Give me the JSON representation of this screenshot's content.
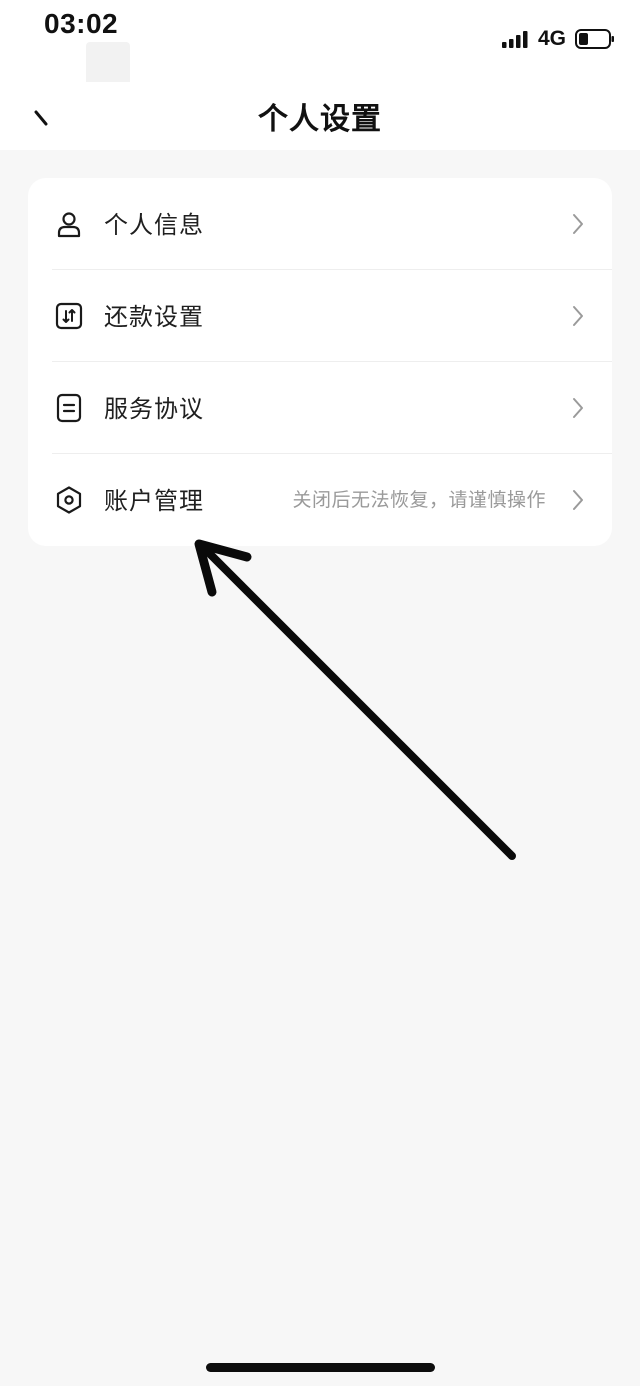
{
  "status_bar": {
    "time": "03:02",
    "network": "4G",
    "icons": [
      "signal-icon",
      "battery-icon"
    ]
  },
  "nav": {
    "title": "个人设置",
    "back_icon": "back-arrow-icon"
  },
  "settings": {
    "items": [
      {
        "label": "个人信息",
        "icon": "person-icon",
        "hint": ""
      },
      {
        "label": "还款设置",
        "icon": "repayment-icon",
        "hint": ""
      },
      {
        "label": "服务协议",
        "icon": "document-icon",
        "hint": ""
      },
      {
        "label": "账户管理",
        "icon": "hexagon-settings-icon",
        "hint": "关闭后无法恢复，请谨慎操作"
      }
    ]
  },
  "colors": {
    "background": "#f7f7f7",
    "card": "#ffffff",
    "text": "#1f1f1f",
    "hint": "#9a9a9a",
    "divider": "#eeeeee"
  }
}
